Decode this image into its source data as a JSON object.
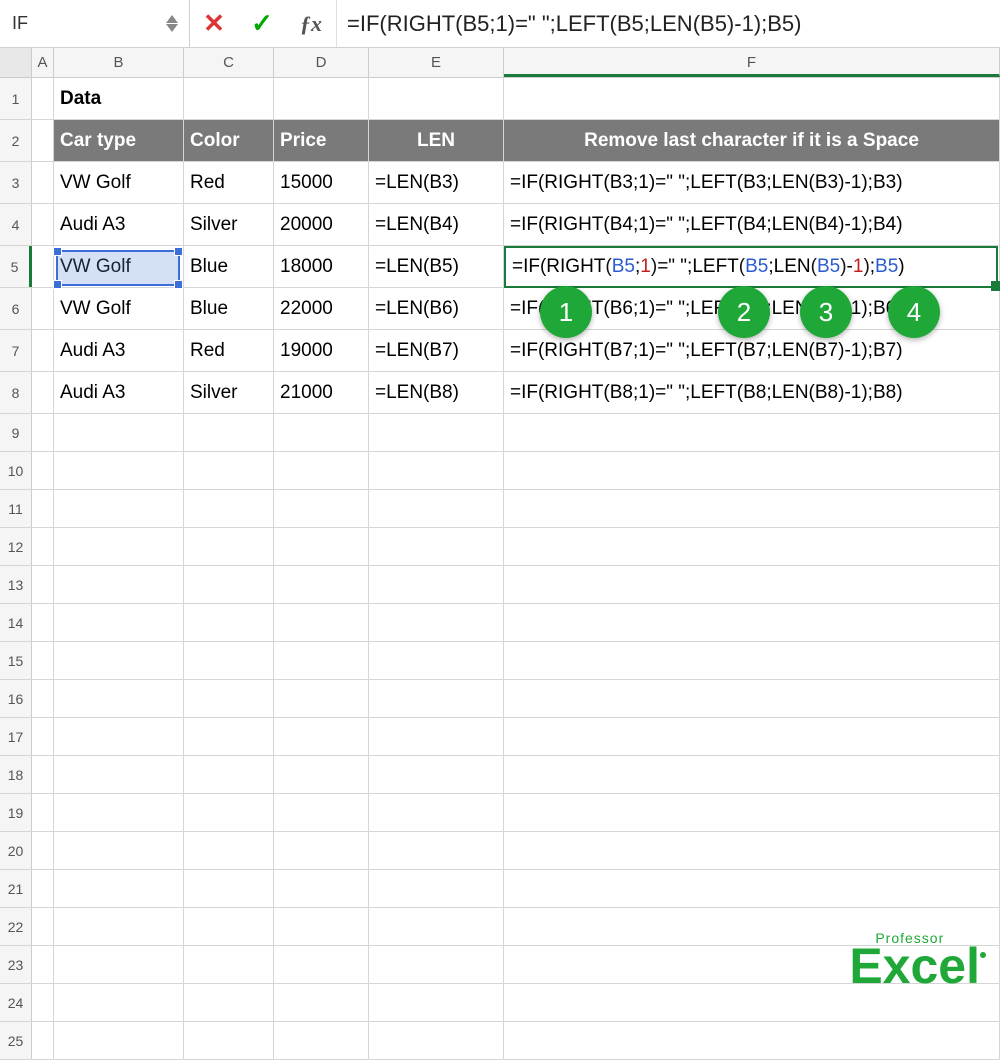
{
  "namebox": "IF",
  "formula": "=IF(RIGHT(B5;1)=\" \";LEFT(B5;LEN(B5)-1);B5)",
  "fx_label": "ƒx",
  "columns": [
    "A",
    "B",
    "C",
    "D",
    "E",
    "F"
  ],
  "row_numbers": [
    1,
    2,
    3,
    4,
    5,
    6,
    7,
    8,
    9,
    10,
    11,
    12,
    13,
    14,
    15,
    16,
    17,
    18,
    19,
    20,
    21,
    22,
    23,
    24,
    25
  ],
  "data_label": "Data",
  "headers": {
    "car_type": "Car type",
    "color": "Color",
    "price": "Price",
    "len": "LEN",
    "remove": "Remove last character if it is a Space"
  },
  "rows": [
    {
      "car": "VW Golf",
      "color": "Red",
      "price": "15000",
      "len": "=LEN(B3)",
      "formula": "=IF(RIGHT(B3;1)=\" \";LEFT(B3;LEN(B3)-1);B3)"
    },
    {
      "car": "Audi A3",
      "color": "Silver",
      "price": "20000",
      "len": "=LEN(B4)",
      "formula": "=IF(RIGHT(B4;1)=\" \";LEFT(B4;LEN(B4)-1);B4)"
    },
    {
      "car": "VW Golf",
      "color": "Blue",
      "price": "18000",
      "len": "=LEN(B5)",
      "formula": "=IF(RIGHT(B5;1)=\" \";LEFT(B5;LEN(B5)-1);B5)"
    },
    {
      "car": "VW Golf",
      "color": "Blue",
      "price": "22000",
      "len": "=LEN(B6)",
      "formula": "=IF(RIGHT(B6;1)=\" \";LEFT(B6;LEN(B6)-1);B6)"
    },
    {
      "car": "Audi A3",
      "color": "Red",
      "price": "19000",
      "len": "=LEN(B7)",
      "formula": "=IF(RIGHT(B7;1)=\" \";LEFT(B7;LEN(B7)-1);B7)"
    },
    {
      "car": "Audi A3",
      "color": "Silver",
      "price": "21000",
      "len": "=LEN(B8)",
      "formula": "=IF(RIGHT(B8;1)=\" \";LEFT(B8;LEN(B8)-1);B8)"
    }
  ],
  "edit_formula_parts": {
    "p1": "=IF(RIGHT",
    "p2": "(",
    "p3": "B5",
    "p4": ";",
    "p5": "1",
    "p6": ")",
    "p7": "=\" \";LEFT",
    "p8": "(",
    "p9": "B5",
    "p10": ";LEN",
    "p11": "(",
    "p12": "B5",
    "p13": ")",
    "p14": "-",
    "p15": "1",
    "p16": ")",
    "p17": ";",
    "p18": "B5",
    "p19": ")"
  },
  "callouts": [
    "1",
    "2",
    "3",
    "4"
  ],
  "logo": {
    "top": "Professor",
    "main": "Excel"
  }
}
